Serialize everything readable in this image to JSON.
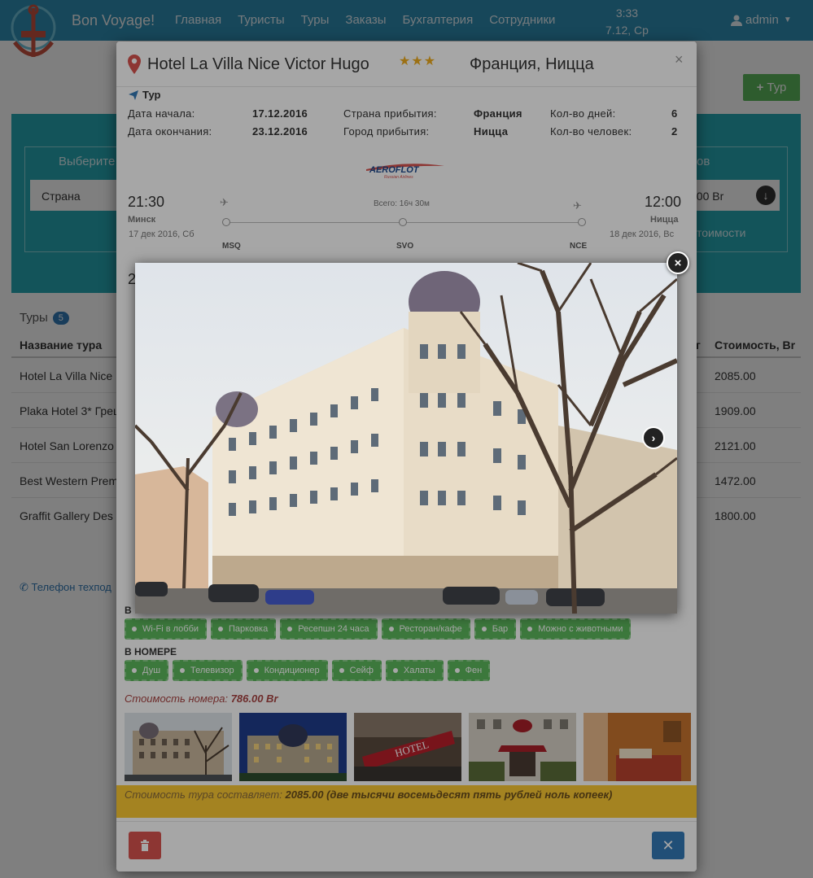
{
  "nav": {
    "brand": "Bon Voyage!",
    "items": [
      "Главная",
      "Туристы",
      "Туры",
      "Заказы",
      "Бухгалтерия",
      "Сотрудники"
    ],
    "time": "3:33",
    "date": "7.12, Ср",
    "user": "admin"
  },
  "page": {
    "add_tour": "Тур",
    "filter_label_left": "Выберите",
    "filter_label_right": "ов",
    "country_placeholder": "Страна",
    "price_value": "500 Br",
    "filter_link": "тоимости",
    "tours_title": "Туры",
    "tours_count": "5",
    "col_name": "Название тура",
    "col_mid": "г",
    "col_price": "Стоимость, Br",
    "rows": [
      {
        "name": "Hotel La Villa Nice",
        "price": "2085.00"
      },
      {
        "name": "Plaka Hotel 3* Грец",
        "price": "1909.00"
      },
      {
        "name": "Hotel San Lorenzo",
        "price": "2121.00"
      },
      {
        "name": "Best Western Prem",
        "price": "1472.00"
      },
      {
        "name": "Graffit Gallery Des",
        "price": "1800.00"
      }
    ],
    "support": "Телефон техпод"
  },
  "modal": {
    "hotel_name": "Hotel La Villa Nice Victor Hugo",
    "stars": "★★★",
    "location": "Франция, Ницца",
    "close": "×",
    "tour_section": "Тур",
    "start_label": "Дата начала:",
    "start_value": "17.12.2016",
    "end_label": "Дата окончания:",
    "end_value": "23.12.2016",
    "country_label": "Страна прибытия:",
    "country_value": "Франция",
    "city_label": "Город прибытия:",
    "city_value": "Ницца",
    "days_label": "Кол-во дней:",
    "days_value": "6",
    "people_label": "Кол-во человек:",
    "people_value": "2",
    "airline": "AEROFLOT",
    "airline_sub": "Russian Airlines",
    "flight": {
      "dep_time": "21:30",
      "dep_city": "Минск",
      "dep_date": "17 дек 2016, Сб",
      "total": "Всего: 16ч 30м",
      "arr_time": "12:00",
      "arr_city": "Ницца",
      "arr_date": "18 дек 2016, Вс",
      "codes": [
        "MSQ",
        "SVO",
        "NCE"
      ]
    },
    "return_time_partial": "2",
    "in_hotel_label": "В",
    "hotel_amenities": [
      "Wi-Fi в лобби",
      "Парковка",
      "Ресепшн 24 часа",
      "Ресторан/кафе",
      "Бар",
      "Можно с животными"
    ],
    "room_label": "В НОМЕРЕ",
    "room_amenities": [
      "Душ",
      "Телевизор",
      "Кондиционер",
      "Сейф",
      "Халаты",
      "Фен"
    ],
    "room_price_label": "Стоимость номера:",
    "room_price_value": "786.00 Br",
    "total_label": "Стоимость тура составляет:",
    "total_value": "2085.00 (две тысячи восемьдесят пять рублей ноль копеек)",
    "delete_icon": "trash-icon",
    "close_icon": "times-icon"
  },
  "lightbox": {
    "close": "×",
    "next": "›"
  },
  "colors": {
    "navbar": "#2f8fb5",
    "accent_green": "#5cb85c",
    "filter_panel": "#27a8b5",
    "total_bar": "#fcc934",
    "danger": "#d9534f",
    "primary": "#337ab7",
    "stars": "#f0ad1e"
  }
}
